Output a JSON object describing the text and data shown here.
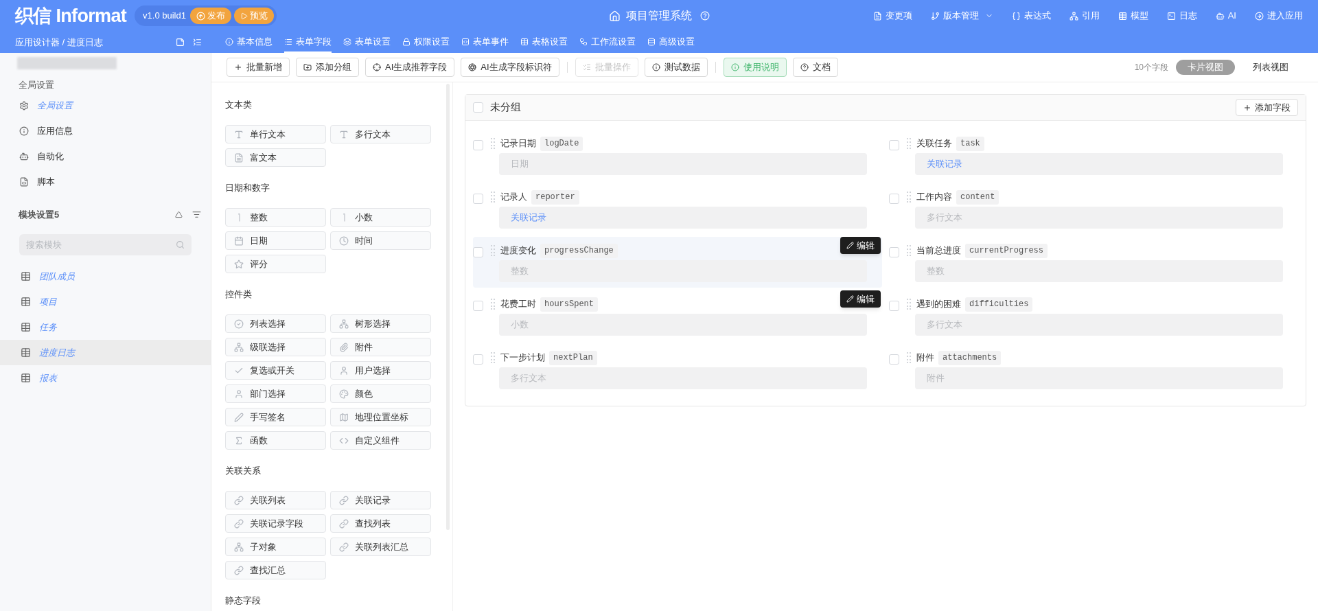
{
  "header": {
    "logo": "织信 Informat",
    "version": "v1.0 build1",
    "publish": "发布",
    "preview": "预览",
    "title": "项目管理系统",
    "menu": [
      {
        "label": "变更项"
      },
      {
        "label": "版本管理",
        "dropdown": true
      },
      {
        "label": "表达式"
      },
      {
        "label": "引用"
      },
      {
        "label": "模型"
      },
      {
        "label": "日志"
      },
      {
        "label": "AI"
      },
      {
        "label": "进入应用"
      }
    ]
  },
  "breadcrumb": "应用设计器 / 进度日志",
  "tabs": [
    {
      "label": "基本信息",
      "selected": false
    },
    {
      "label": "表单字段",
      "selected": true
    },
    {
      "label": "表单设置",
      "selected": false
    },
    {
      "label": "权限设置",
      "selected": false
    },
    {
      "label": "表单事件",
      "selected": false
    },
    {
      "label": "表格设置",
      "selected": false
    },
    {
      "label": "工作流设置",
      "selected": false
    },
    {
      "label": "高级设置",
      "selected": false
    }
  ],
  "sidebar": {
    "global_title": "全局设置",
    "global_items": [
      {
        "label": "全局设置",
        "active": true
      },
      {
        "label": "应用信息",
        "active": false
      },
      {
        "label": "自动化",
        "active": false
      },
      {
        "label": "脚本",
        "active": false
      }
    ],
    "modules_title": "模块设置5",
    "search": {
      "placeholder": "搜索模块"
    },
    "modules": [
      {
        "label": "团队成员",
        "selected": false
      },
      {
        "label": "项目",
        "selected": false
      },
      {
        "label": "任务",
        "selected": false
      },
      {
        "label": "进度日志",
        "selected": true
      },
      {
        "label": "报表",
        "selected": false
      }
    ]
  },
  "toolbar": {
    "buttons": [
      {
        "kind": "add",
        "label": "批量新增",
        "disabled": false,
        "highlighted": false
      },
      {
        "kind": "group",
        "label": "添加分组",
        "disabled": false,
        "highlighted": false
      },
      {
        "kind": "ai",
        "label": "AI生成推荐字段",
        "disabled": false,
        "highlighted": false
      },
      {
        "kind": "ai_id",
        "label": "AI生成字段标识符",
        "disabled": false,
        "highlighted": false
      },
      {
        "kind": "separator"
      },
      {
        "kind": "batch",
        "label": "批量操作",
        "disabled": true,
        "highlighted": false
      },
      {
        "kind": "test",
        "label": "测试数据",
        "disabled": false,
        "highlighted": false
      },
      {
        "kind": "separator"
      },
      {
        "kind": "help",
        "label": "使用说明",
        "disabled": false,
        "highlighted": true
      },
      {
        "kind": "doc",
        "label": "文档",
        "disabled": false,
        "highlighted": false
      }
    ],
    "field_count": "10个字段",
    "views": [
      {
        "label": "卡片视图",
        "selected": true
      },
      {
        "label": "列表视图",
        "selected": false
      }
    ]
  },
  "palette": [
    {
      "title": "文本类",
      "items": [
        {
          "label": "单行文本",
          "kind": "text"
        },
        {
          "label": "多行文本",
          "kind": "text"
        },
        {
          "label": "富文本",
          "kind": "rich"
        }
      ]
    },
    {
      "title": "日期和数字",
      "items": [
        {
          "label": "整数",
          "kind": "number"
        },
        {
          "label": "小数",
          "kind": "number"
        },
        {
          "label": "日期",
          "kind": "date"
        },
        {
          "label": "时间",
          "kind": "time"
        },
        {
          "label": "评分",
          "kind": "rating"
        }
      ]
    },
    {
      "title": "控件类",
      "items": [
        {
          "label": "列表选择",
          "kind": "select"
        },
        {
          "label": "树形选择",
          "kind": "tree"
        },
        {
          "label": "级联选择",
          "kind": "tree"
        },
        {
          "label": "附件",
          "kind": "attachment"
        },
        {
          "label": "复选或开关",
          "kind": "check"
        },
        {
          "label": "用户选择",
          "kind": "user"
        },
        {
          "label": "部门选择",
          "kind": "user"
        },
        {
          "label": "颜色",
          "kind": "color"
        },
        {
          "label": "手写签名",
          "kind": "signature"
        },
        {
          "label": "地理位置坐标",
          "kind": "map"
        },
        {
          "label": "函数",
          "kind": "formula"
        },
        {
          "label": "自定义组件",
          "kind": "code"
        }
      ]
    },
    {
      "title": "关联关系",
      "items": [
        {
          "label": "关联列表",
          "kind": "link"
        },
        {
          "label": "关联记录",
          "kind": "link"
        },
        {
          "label": "关联记录字段",
          "kind": "link"
        },
        {
          "label": "查找列表",
          "kind": "link"
        },
        {
          "label": "子对象",
          "kind": "tree"
        },
        {
          "label": "关联列表汇总",
          "kind": "link"
        },
        {
          "label": "查找汇总",
          "kind": "link"
        }
      ]
    },
    {
      "title": "静态字段"
    }
  ],
  "group": {
    "title": "未分组",
    "checked": false,
    "add_field": "添加字段",
    "fields": [
      {
        "label": "记录日期",
        "code": "logDate",
        "value": "日期",
        "link": false,
        "checked": false,
        "hovered": false
      },
      {
        "label": "关联任务",
        "code": "task",
        "value": "关联记录",
        "link": true,
        "checked": false,
        "hovered": false
      },
      {
        "label": "记录人",
        "code": "reporter",
        "value": "关联记录",
        "link": true,
        "checked": false,
        "hovered": false
      },
      {
        "label": "工作内容",
        "code": "content",
        "value": "多行文本",
        "link": false,
        "checked": false,
        "hovered": false
      },
      {
        "label": "进度变化",
        "code": "progressChange",
        "value": "整数",
        "link": false,
        "checked": false,
        "hovered": true,
        "edit": "编辑"
      },
      {
        "label": "当前总进度",
        "code": "currentProgress",
        "value": "整数",
        "link": false,
        "checked": false,
        "hovered": false
      },
      {
        "label": "花费工时",
        "code": "hoursSpent",
        "value": "小数",
        "link": false,
        "checked": false,
        "hovered": false,
        "edit": "编辑"
      },
      {
        "label": "遇到的困难",
        "code": "difficulties",
        "value": "多行文本",
        "link": false,
        "checked": false,
        "hovered": false
      },
      {
        "label": "下一步计划",
        "code": "nextPlan",
        "value": "多行文本",
        "link": false,
        "checked": false,
        "hovered": false
      },
      {
        "label": "附件",
        "code": "attachments",
        "value": "附件",
        "link": false,
        "checked": false,
        "hovered": false
      }
    ]
  }
}
